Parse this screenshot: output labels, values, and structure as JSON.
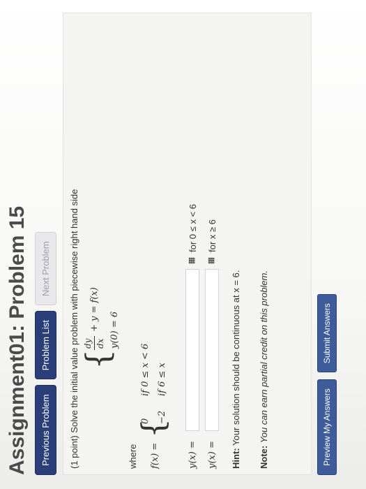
{
  "header": {
    "title": "Assignment01: Problem 15"
  },
  "nav": {
    "previous": "Previous Problem",
    "list": "Problem List",
    "next": "Next Problem"
  },
  "problem": {
    "intro": "(1 point) Solve the initial value problem with piecewise right hand side",
    "ode_numerator": "dy",
    "ode_denominator": "dx",
    "ode_rest": "+ y = f(x)",
    "ic": "y(0) = 6",
    "where": "where",
    "f_lhs": "f(x) =",
    "f_case1_val": "0",
    "f_case1_cond": "if  0 ≤ x < 6",
    "f_case2_val": "−2",
    "f_case2_cond": "if  6 ≤ x",
    "y1_label": "y(x) =",
    "y1_cond": "for 0 ≤ x < 6",
    "y2_label": "y(x) =",
    "y2_cond": "for x ≥ 6",
    "hint_label": "Hint:",
    "hint_text": "Your solution should be continuous at x = 6.",
    "note_label": "Note:",
    "note_text": "You can earn partial credit on this problem."
  },
  "footer": {
    "preview": "Preview My Answers",
    "submit": "Submit Answers"
  },
  "icons": {
    "grid": "grid-icon",
    "brace": "left-brace"
  }
}
